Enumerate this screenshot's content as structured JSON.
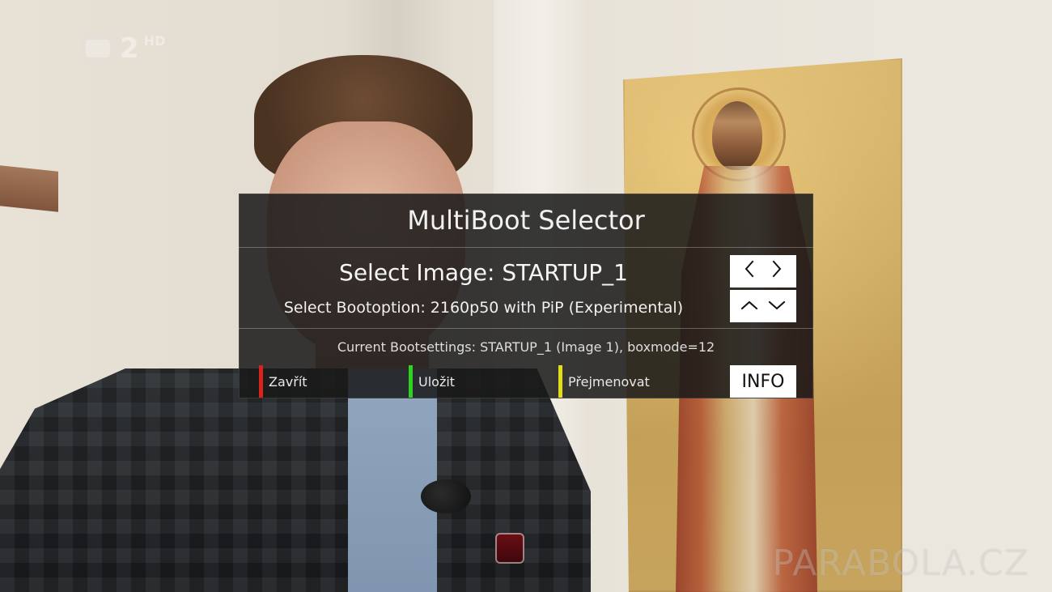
{
  "channel_logo": {
    "number": "2",
    "hd_label": "HD"
  },
  "watermark": "PARABOLA.CZ",
  "dialog": {
    "title": "MultiBoot Selector",
    "select_image": "Select Image: STARTUP_1",
    "select_bootoption": "Select Bootoption: 2160p50 with PiP (Experimental)",
    "nav_keys": {
      "left": "<",
      "right": ">",
      "up": "^",
      "down": "v"
    },
    "current_bootsettings": "Current Bootsettings: STARTUP_1 (Image 1), boxmode=12",
    "color_keys": {
      "red": "Zavřít",
      "green": "Uložit",
      "yellow": "Přejmenovat"
    },
    "info_button": "INFO"
  },
  "colors": {
    "overlay_bg": "#181818",
    "red_key": "#d9231d",
    "green_key": "#2fd31f",
    "yellow_key": "#e2dc19"
  },
  "icons": {
    "left": "chevron-left-icon",
    "right": "chevron-right-icon",
    "up": "chevron-up-icon",
    "down": "chevron-down-icon"
  }
}
